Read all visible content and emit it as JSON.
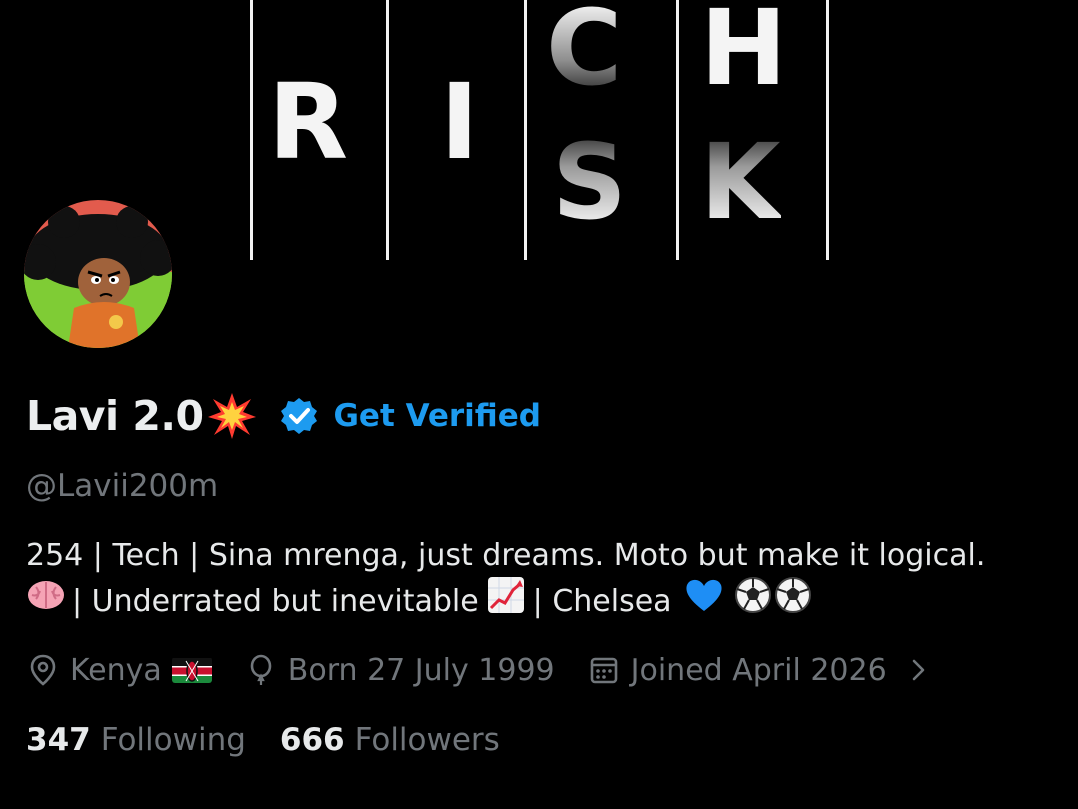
{
  "banner": {
    "letters": [
      "R",
      "I",
      "C",
      "H",
      "S",
      "K"
    ],
    "colors": {
      "background": "#000000",
      "text": "#f4f4f4"
    }
  },
  "profile": {
    "display_name": "Lavi 2.0",
    "name_emoji": "collision-emoji",
    "verified_icon": "verified-badge-icon",
    "verify_label": "Get Verified",
    "handle": "@Lavii200m",
    "bio_line1": "254 | Tech | Sina mrenga, just dreams. Moto but make it logical.",
    "bio_line2_a": "| Underrated but inevitable",
    "bio_line2_b": "| Chelsea",
    "location": "Kenya",
    "birth": "Born 27 July 1999",
    "joined": "Joined April 2026",
    "following_count": "347",
    "following_label": "Following",
    "followers_count": "666",
    "followers_label": "Followers"
  },
  "colors": {
    "accent": "#1d9bf0",
    "secondary_text": "#71767b",
    "primary_text": "#e7e9ea"
  }
}
